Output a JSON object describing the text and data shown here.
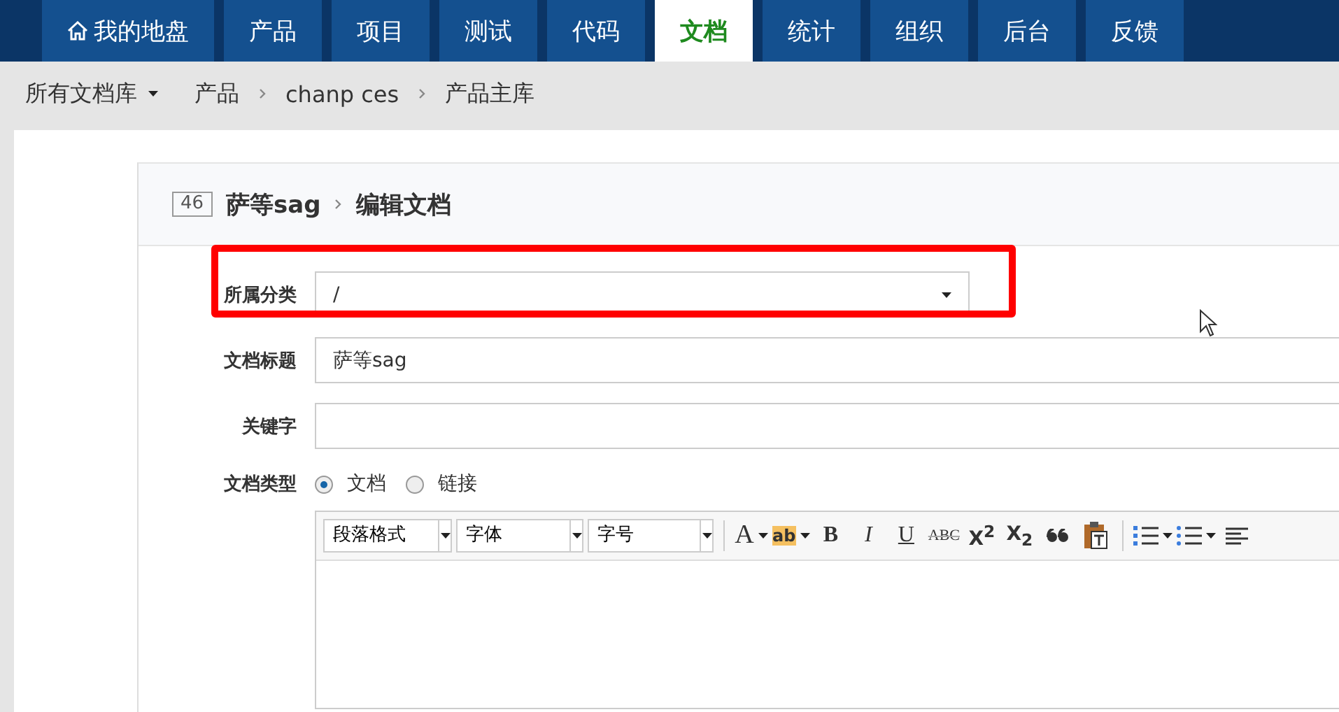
{
  "nav": {
    "items": [
      {
        "label": "我的地盘",
        "selected": false
      },
      {
        "label": "产品",
        "selected": false
      },
      {
        "label": "项目",
        "selected": false
      },
      {
        "label": "测试",
        "selected": false
      },
      {
        "label": "代码",
        "selected": false
      },
      {
        "label": "文档",
        "selected": true
      },
      {
        "label": "统计",
        "selected": false
      },
      {
        "label": "组织",
        "selected": false
      },
      {
        "label": "后台",
        "selected": false
      },
      {
        "label": "反馈",
        "selected": false
      }
    ]
  },
  "breadcrumb": {
    "menu": "所有文档库",
    "items": [
      "产品",
      "chanp ces",
      "产品主库"
    ]
  },
  "panel": {
    "id": "46",
    "title": "萨等sag",
    "action": "编辑文档"
  },
  "form": {
    "category": {
      "label": "所属分类",
      "value": "/"
    },
    "title": {
      "label": "文档标题",
      "value": "萨等sag"
    },
    "keywords": {
      "label": "关键字"
    },
    "type": {
      "label": "文档类型",
      "options": [
        {
          "label": "文档",
          "selected": true
        },
        {
          "label": "链接",
          "selected": false
        }
      ]
    }
  },
  "editor": {
    "selects": [
      "段落格式",
      "字体",
      "字号"
    ],
    "buttons": [
      {
        "kind": "color",
        "label": "A"
      },
      {
        "kind": "highlight",
        "label": "ab"
      },
      {
        "kind": "bold",
        "label": "B"
      },
      {
        "kind": "italic",
        "label": "I"
      },
      {
        "kind": "underline",
        "label": "U"
      },
      {
        "kind": "strike",
        "label": "ABC"
      },
      {
        "kind": "sup",
        "label": "X$^{2}$"
      },
      {
        "kind": "sub",
        "label": "X$_{2}$"
      },
      {
        "kind": "quote"
      },
      {
        "kind": "paste"
      },
      {
        "kind": "sep"
      },
      {
        "kind": "ol"
      },
      {
        "kind": "ul"
      },
      {
        "kind": "align"
      }
    ]
  }
}
